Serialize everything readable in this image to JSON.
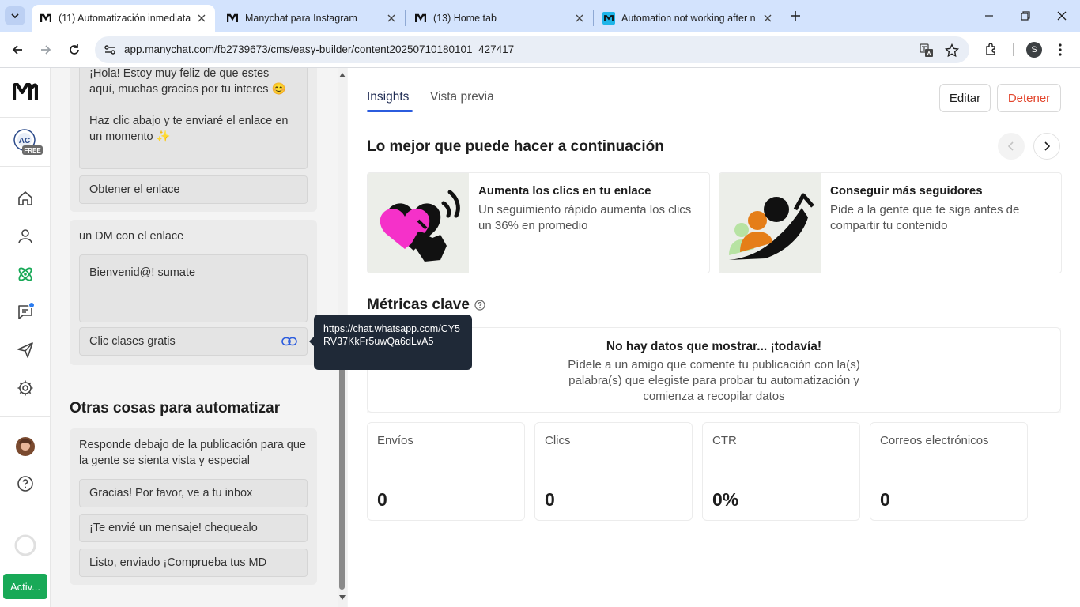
{
  "browser": {
    "tabs": [
      {
        "title": "(11) Automatización inmediata",
        "icon": "manychat-logo-icon"
      },
      {
        "title": "Manychat para Instagram",
        "icon": "manychat-logo-icon"
      },
      {
        "title": "(13) Home tab",
        "icon": "manychat-logo-icon"
      },
      {
        "title": "Automation not working after n",
        "icon": "manychat-help-icon"
      }
    ],
    "url": "app.manychat.com/fb2739673/cms/easy-builder/content20250710180101_427417",
    "profile_initial": "S"
  },
  "leftnav": {
    "badge": "FREE",
    "activate_label": "Activ..."
  },
  "flow": {
    "welcome_message_1": "¡Hola! Estoy muy feliz de que estes aquí, muchas gracias por tu interes 😊",
    "welcome_message_2": "Haz clic abajo y te enviaré el enlace en un momento ✨",
    "get_link_button": "Obtener el enlace",
    "dm_section_label": "un DM con el enlace",
    "dm_message": "Bienvenid@! sumate",
    "link_button": "Clic clases gratis",
    "link_tooltip": "https://chat.whatsapp.com/CY5RV37KkFr5uwQa6dLvA5"
  },
  "other": {
    "title": "Otras cosas para automatizar",
    "description": "Responde debajo de la publicación para que la gente se sienta vista y especial",
    "replies": [
      "Gracias! Por favor, ve a tu inbox",
      "¡Te envié un mensaje!  chequealo",
      "Listo, enviado ¡Comprueba tus MD"
    ]
  },
  "main": {
    "tabs": [
      "Insights",
      "Vista previa"
    ],
    "edit_button": "Editar",
    "stop_button": "Detener",
    "next_title": "Lo mejor que puede hacer a continuación",
    "recommendations": [
      {
        "title": "Aumenta los clics en tu enlace",
        "description": "Un seguimiento rápido aumenta los clics un 36% en promedio"
      },
      {
        "title": "Conseguir más seguidores",
        "description": "Pide a la gente que te siga antes de compartir tu contenido"
      }
    ],
    "metrics_title": "Métricas clave",
    "no_data_title": "No hay datos que mostrar... ¡todavía!",
    "no_data_description": "Pídele a un amigo que comente tu publicación con la(s) palabra(s) que elegiste para probar tu automatización y comienza a recopilar datos",
    "metrics": [
      {
        "label": "Envíos",
        "value": "0"
      },
      {
        "label": "Clics",
        "value": "0"
      },
      {
        "label": "CTR",
        "value": "0%"
      },
      {
        "label": "Correos electrónicos",
        "value": "0"
      }
    ]
  },
  "colors": {
    "accent": "#2b5cde",
    "stop": "#e2452c",
    "active_green": "#18a957",
    "heart": "#f531c9"
  }
}
